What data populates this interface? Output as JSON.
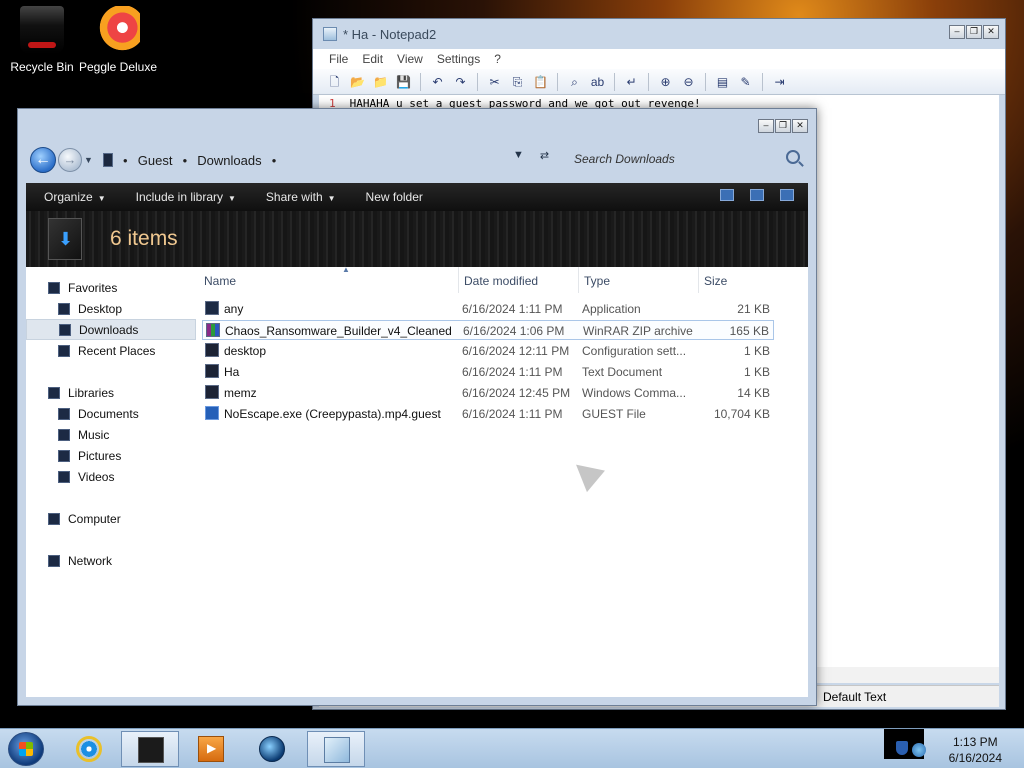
{
  "desktop": {
    "icons": [
      {
        "label": "Recycle Bin",
        "icon": "recycle-bin-icon"
      },
      {
        "label": "Peggle Deluxe",
        "icon": "peggle-icon"
      }
    ]
  },
  "notepad": {
    "title": "* Ha - Notepad2",
    "menu": [
      "File",
      "Edit",
      "View",
      "Settings",
      "?"
    ],
    "line_number": "1",
    "text": "HAHAHA u set a guest password and we got out revenge!",
    "status_encoding": "Default Text"
  },
  "explorer": {
    "breadcrumb": [
      "Guest",
      "Downloads"
    ],
    "search_placeholder": "Search Downloads",
    "commands": [
      "Organize",
      "Include in library",
      "Share with",
      "New folder"
    ],
    "item_count": "6 items",
    "nav": {
      "favorites_label": "Favorites",
      "favorites": [
        "Desktop",
        "Downloads",
        "Recent Places"
      ],
      "libraries_label": "Libraries",
      "libraries": [
        "Documents",
        "Music",
        "Pictures",
        "Videos"
      ],
      "computer_label": "Computer",
      "network_label": "Network",
      "selected": "Downloads"
    },
    "columns": [
      "Name",
      "Date modified",
      "Type",
      "Size"
    ],
    "files": [
      {
        "name": "any",
        "date": "6/16/2024 1:11 PM",
        "type": "Application",
        "size": "21 KB",
        "icon": "exe"
      },
      {
        "name": "Chaos_Ransomware_Builder_v4_Cleaned",
        "date": "6/16/2024 1:06 PM",
        "type": "WinRAR ZIP archive",
        "size": "165 KB",
        "icon": "rar"
      },
      {
        "name": "desktop",
        "date": "6/16/2024 12:11 PM",
        "type": "Configuration sett...",
        "size": "1 KB",
        "icon": "ini"
      },
      {
        "name": "Ha",
        "date": "6/16/2024 1:11 PM",
        "type": "Text Document",
        "size": "1 KB",
        "icon": "txt"
      },
      {
        "name": "memz",
        "date": "6/16/2024 12:45 PM",
        "type": "Windows Comma...",
        "size": "14 KB",
        "icon": "bat"
      },
      {
        "name": "NoEscape.exe (Creepypasta).mp4.guest",
        "date": "6/16/2024 1:11 PM",
        "type": "GUEST File",
        "size": "10,704 KB",
        "icon": "guest"
      }
    ]
  },
  "taskbar": {
    "time": "1:13 PM",
    "date": "6/16/2024"
  }
}
